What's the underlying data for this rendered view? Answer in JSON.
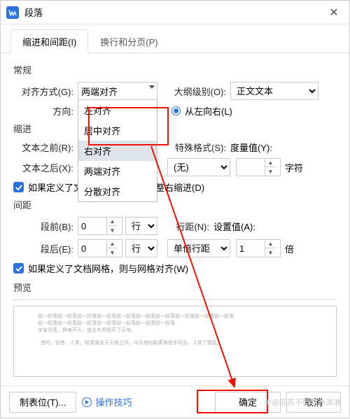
{
  "titlebar": {
    "title": "段落"
  },
  "tabs": {
    "tab1": "缩进和间距(I)",
    "tab2": "换行和分页(P)"
  },
  "section": {
    "general": "常规",
    "indent": "缩进",
    "spacing": "间距",
    "preview": "预览"
  },
  "labels": {
    "align": "对齐方式(G):",
    "outline": "大纲级别(O):",
    "direction": "方向:",
    "ltr": "从左向右(L)",
    "before_text": "文本之前(R):",
    "after_text": "文本之后(X):",
    "special": "特殊格式(S):",
    "measure": "度量值(Y):",
    "unit_char": "字符",
    "auto_adjust": "如果定义了文档网格，则自动调整右缩进(D)",
    "before_para": "段前(B):",
    "after_para": "段后(E):",
    "unit_line": "行",
    "line_spacing": "行距(N):",
    "set_value": "设置值(A):",
    "unit_times": "倍",
    "snap_grid": "如果定义了文档网格，则与网格对齐(W)"
  },
  "values": {
    "align": "两端对齐",
    "outline": "正文文本",
    "before_text": "",
    "after_text": "",
    "special": "(无)",
    "measure": "",
    "before_para": "0",
    "after_para": "0",
    "line_spacing": "单倍行距",
    "set_value": "1"
  },
  "dropdown": {
    "opt1": "左对齐",
    "opt2": "居中对齐",
    "opt3": "右对齐",
    "opt4": "两端对齐",
    "opt5": "分散对齐"
  },
  "buttons": {
    "tabstop": "制表位(T)...",
    "tips": "操作技巧",
    "ok": "确定",
    "cancel": "取消"
  },
  "watermark": "⊕@苏苏不要吃冰淇淋"
}
